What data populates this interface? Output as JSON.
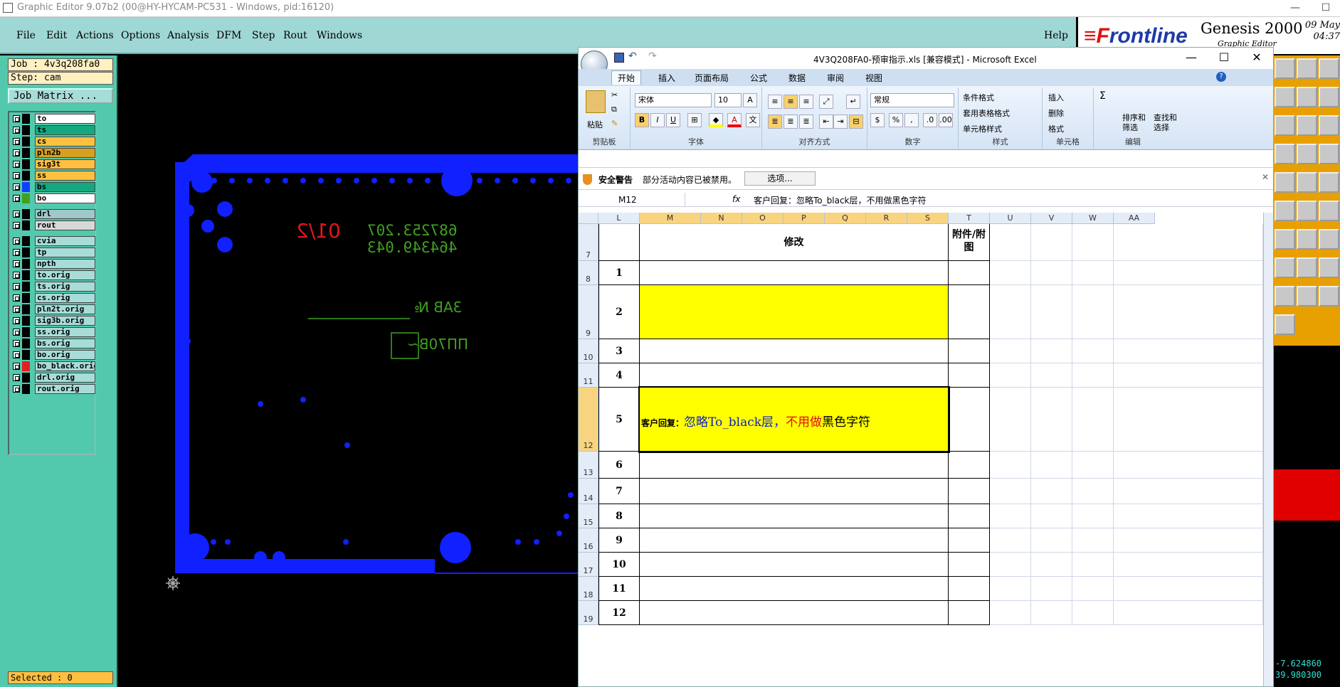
{
  "window": {
    "title": "Graphic Editor 9.07b2 (00@HY-HYCAM-PC531 - Windows, pid:16120)"
  },
  "menu": {
    "items": [
      "File",
      "Edit",
      "Actions",
      "Options",
      "Analysis",
      "DFM",
      "Step",
      "Rout",
      "Windows"
    ],
    "help": "Help"
  },
  "brand": {
    "logo_prefix": "F",
    "logo_rest": "rontline",
    "product": "Genesis 2000",
    "subtitle": "Graphic Editor",
    "date": "09 May",
    "time": "04:37"
  },
  "job": {
    "job_line": "Job : 4v3q208fa0",
    "step_line": "Step: cam",
    "matrix_btn": "Job Matrix ..."
  },
  "layers": [
    {
      "name": "to",
      "color": "#ffffff",
      "sw": "#000000"
    },
    {
      "name": "ts",
      "color": "#15a87f",
      "sw": "#000000"
    },
    {
      "name": "cs",
      "color": "#ffc040",
      "sw": "#000000"
    },
    {
      "name": "pln2b",
      "color": "#d8a020",
      "sw": "#000000"
    },
    {
      "name": "sig3t",
      "color": "#ffc040",
      "sw": "#000000"
    },
    {
      "name": "ss",
      "color": "#ffc040",
      "sw": "#000000"
    },
    {
      "name": "bs",
      "color": "#15a87f",
      "sw": "#1040ff"
    },
    {
      "name": "bo",
      "color": "#ffffff",
      "sw": "#40a020"
    },
    {
      "name": "drl",
      "color": "#a0c8c8",
      "sw": "#000000"
    },
    {
      "name": "rout",
      "color": "#d8d8d8",
      "sw": "#000000"
    },
    {
      "name": "cvia",
      "color": "#a8dcd8",
      "sw": "#000000"
    },
    {
      "name": "tp",
      "color": "#a8dcd8",
      "sw": "#000000"
    },
    {
      "name": "npth",
      "color": "#a8dcd8",
      "sw": "#000000"
    },
    {
      "name": "to.orig",
      "color": "#a8dcd8",
      "sw": "#000000"
    },
    {
      "name": "ts.orig",
      "color": "#a8dcd8",
      "sw": "#000000"
    },
    {
      "name": "cs.orig",
      "color": "#a8dcd8",
      "sw": "#000000"
    },
    {
      "name": "pln2t.orig",
      "color": "#a8dcd8",
      "sw": "#000000"
    },
    {
      "name": "sig3b.orig",
      "color": "#a8dcd8",
      "sw": "#000000"
    },
    {
      "name": "ss.orig",
      "color": "#a8dcd8",
      "sw": "#000000"
    },
    {
      "name": "bs.orig",
      "color": "#a8dcd8",
      "sw": "#000000"
    },
    {
      "name": "bo.orig",
      "color": "#a8dcd8",
      "sw": "#000000"
    },
    {
      "name": "bo_black.orig",
      "color": "#a8dcd8",
      "sw": "#e02020"
    },
    {
      "name": "drl.orig",
      "color": "#a8dcd8",
      "sw": "#000000"
    },
    {
      "name": "rout.orig",
      "color": "#a8dcd8",
      "sw": "#000000"
    }
  ],
  "selected": "Selected : 0",
  "canvas_text": {
    "red_num": "01/2",
    "green1": "687253.207",
    "green2": "464349.043",
    "ab": "3AB №",
    "box": "ПП70В~"
  },
  "coords": {
    "x": "-7.624860",
    "y": "39.980300"
  },
  "excel": {
    "title": "4V3Q208FA0-预审指示.xls  [兼容模式] - Microsoft Excel",
    "tabs": [
      "开始",
      "插入",
      "页面布局",
      "公式",
      "数据",
      "审阅",
      "视图"
    ],
    "font_name": "宋体",
    "font_size": "10",
    "number_format": "常规",
    "group_labels": [
      "剪贴板",
      "字体",
      "对齐方式",
      "数字",
      "样式",
      "单元格",
      "编辑"
    ],
    "paste": "粘贴",
    "style_items": [
      "条件格式",
      "套用表格格式",
      "单元格样式"
    ],
    "cell_items": [
      "插入",
      "删除",
      "格式"
    ],
    "edit_items": [
      "排序和",
      "筛选",
      "查找和",
      "选择"
    ],
    "security_title": "安全警告",
    "security_text": "部分活动内容已被禁用。",
    "security_btn": "选项...",
    "namebox": "M12",
    "fx": "fx",
    "formula": "客户回复：忽略To_black层，不用做黑色字符",
    "columns": [
      "L",
      "M",
      "N",
      "O",
      "P",
      "Q",
      "R",
      "S",
      "T",
      "U",
      "V",
      "W",
      "AA"
    ],
    "header_modify": "修改",
    "header_attach": "附件/附图",
    "rows": [
      "7",
      "8",
      "9",
      "10",
      "11",
      "12",
      "13",
      "14",
      "15",
      "16",
      "17",
      "18",
      "19"
    ],
    "nums": [
      "1",
      "2",
      "3",
      "4",
      "5",
      "6",
      "7",
      "8",
      "9",
      "10",
      "11",
      "12"
    ],
    "reply_prefix": "客户回复：",
    "reply_a": "忽略To_black层，",
    "reply_b": "不用做",
    "reply_c": "黑色字符"
  }
}
